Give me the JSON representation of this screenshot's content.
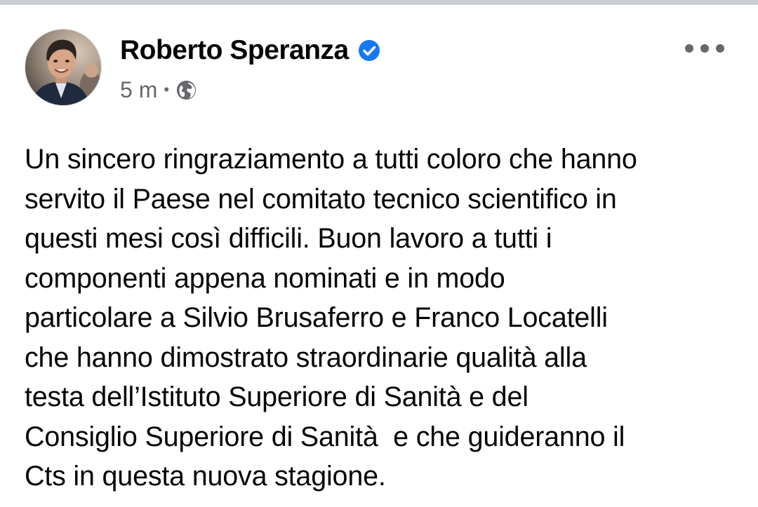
{
  "post": {
    "author": {
      "name": "Roberto Speranza",
      "verified": true,
      "avatar_icon": "profile-photo"
    },
    "meta": {
      "time": "5 m",
      "separator": "•",
      "audience_icon": "globe-icon"
    },
    "menu_icon": "more-horizontal-icon",
    "text": "Un sincero ringraziamento a tutti coloro che hanno\nservito il Paese nel comitato tecnico scientifico in\nquesti mesi così difficili. Buon lavoro a tutti i\ncomponenti appena nominati e in modo\nparticolare a Silvio Brusaferro e Franco Locatelli\nche hanno dimostrato straordinarie qualità alla\ntesta dell’Istituto Superiore di Sanità e del\nConsiglio Superiore di Sanità  e che guideranno il\nCts in questa nuova stagione."
  },
  "colors": {
    "text_primary": "#050505",
    "text_secondary": "#65676b",
    "verified_blue": "#1877f2",
    "divider": "#c9ccd1",
    "background": "#ffffff"
  }
}
